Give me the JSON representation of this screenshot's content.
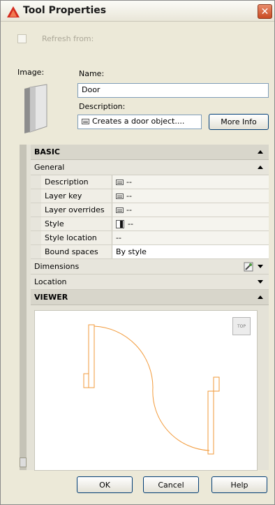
{
  "window": {
    "title": "Tool Properties",
    "close": "✕"
  },
  "refresh": {
    "label": "Refresh from:"
  },
  "fields": {
    "image_label": "Image:",
    "name_label": "Name:",
    "name_value": "Door",
    "description_label": "Description:",
    "description_value": "Creates a door object....",
    "more_info": "More Info"
  },
  "palette": {
    "basic": "BASIC",
    "general": "General",
    "properties": [
      {
        "name": "Description",
        "value": "--",
        "icon": "description-icon"
      },
      {
        "name": "Layer key",
        "value": "--",
        "icon": "description-icon"
      },
      {
        "name": "Layer overrides",
        "value": "--",
        "icon": "description-icon"
      },
      {
        "name": "Style",
        "value": "--",
        "icon": "style-swatch-icon"
      },
      {
        "name": "Style location",
        "value": "--"
      },
      {
        "name": "Bound spaces",
        "value": "By style"
      }
    ],
    "dimensions": "Dimensions",
    "location": "Location",
    "viewer": "VIEWER",
    "viewcube": "TOP"
  },
  "buttons": {
    "ok": "OK",
    "cancel": "Cancel",
    "help": "Help"
  },
  "colors": {
    "door_plan": "#f29a3a",
    "title_close": "#d1552b",
    "field_border": "#7f9db9"
  }
}
